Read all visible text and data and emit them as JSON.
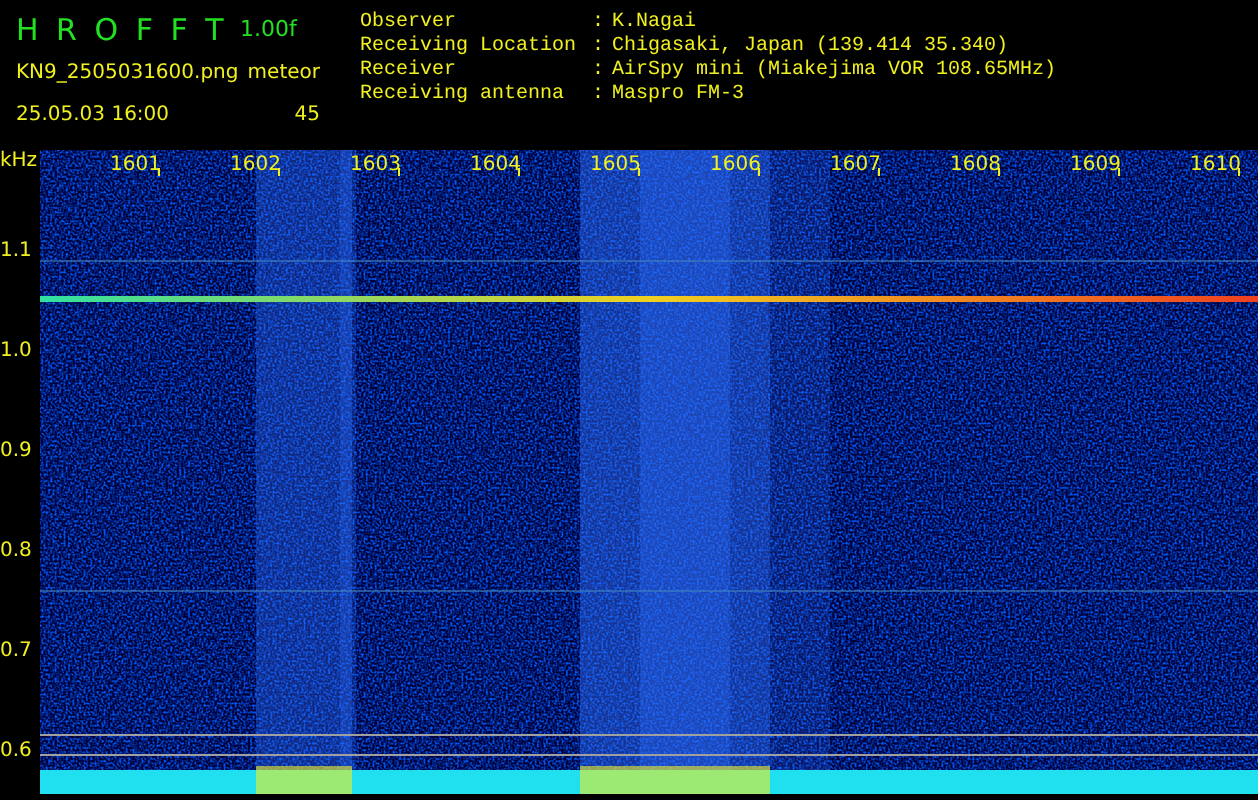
{
  "header": {
    "program": "H R O F F T",
    "version": "1.00f",
    "filename": "KN9_2505031600.png",
    "detector": "meteor",
    "timestamp": "25.05.03 16:00",
    "count": "45"
  },
  "station": [
    {
      "label": "Observer",
      "separator": ":",
      "value": "K.Nagai"
    },
    {
      "label": "Receiving Location",
      "separator": ":",
      "value": "Chigasaki, Japan (139.414 35.340)"
    },
    {
      "label": "Receiver",
      "separator": ":",
      "value": "AirSpy mini (Miakejima VOR 108.65MHz)"
    },
    {
      "label": "Receiving antenna",
      "separator": ":",
      "value": "Maspro FM-3"
    }
  ],
  "spectrogram": {
    "y_unit": "kHz",
    "y_labels": [
      "1.1",
      "1.0",
      "0.9",
      "0.8",
      "0.7",
      "0.6"
    ],
    "time_labels": [
      "1601",
      "1602",
      "1603",
      "1604",
      "1605",
      "1606",
      "1607",
      "1608",
      "1609",
      "1610"
    ]
  }
}
